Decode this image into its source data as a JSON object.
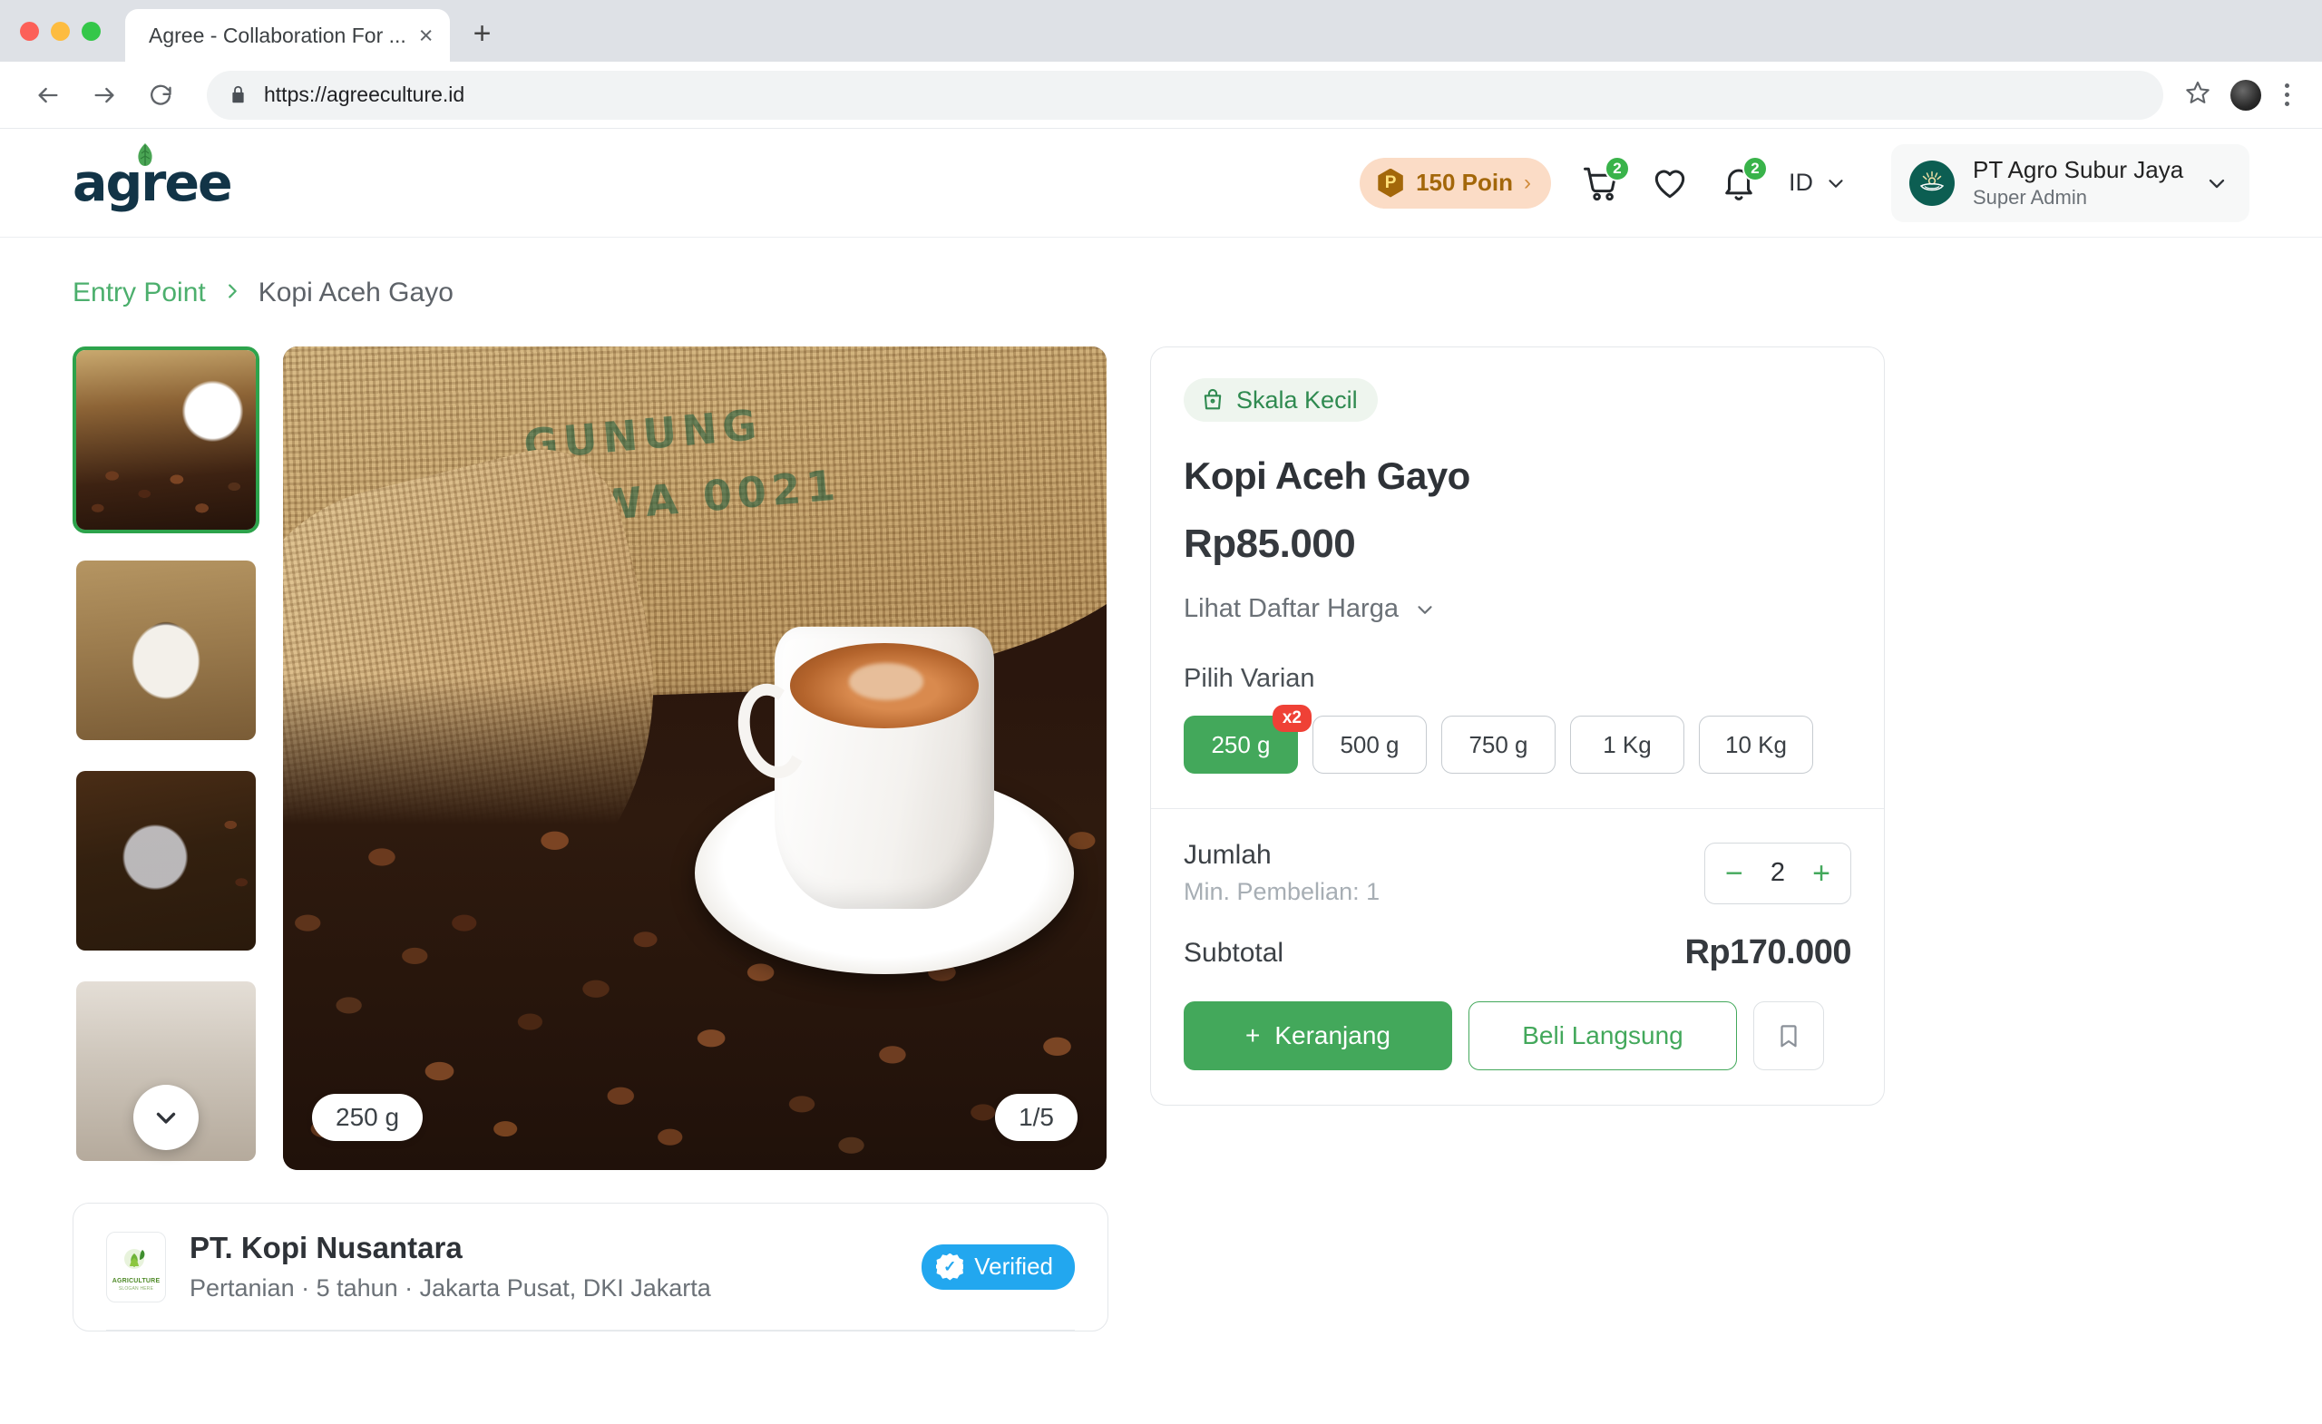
{
  "browser": {
    "tab_title": "Agree - Collaboration For ...",
    "close_label": "×",
    "newtab_label": "+",
    "url": "https://agreeculture.id"
  },
  "header": {
    "logo_text": "agree",
    "points": {
      "label": "150 Poin",
      "icon_letter": "P",
      "chevron": "›"
    },
    "cart": {
      "badge": "2"
    },
    "wishlist": {
      "badge": ""
    },
    "notifications": {
      "badge": "2"
    },
    "language": {
      "label": "ID"
    },
    "profile": {
      "org": "PT Agro Subur Jaya",
      "role": "Super Admin"
    }
  },
  "breadcrumb": {
    "root": "Entry Point",
    "separator": "›",
    "current": "Kopi Aceh Gayo"
  },
  "gallery": {
    "size_pill": "250 g",
    "counter_pill": "1/5",
    "thumbnails": [
      {
        "alt": "coffee beans sack with cup"
      },
      {
        "alt": "cup of black coffee on saucer"
      },
      {
        "alt": "ground coffee with scoop"
      },
      {
        "alt": "coffee pouring"
      }
    ],
    "sack_print": "GUNUNG TAWA\n0021\n100"
  },
  "product": {
    "scale_badge": "Skala Kecil",
    "title": "Kopi Aceh Gayo",
    "price": "Rp85.000",
    "price_list_link": "Lihat Daftar Harga",
    "variant_label": "Pilih Varian",
    "variants": [
      {
        "label": "250 g",
        "selected": true,
        "badge": "x2"
      },
      {
        "label": "500 g",
        "selected": false,
        "badge": ""
      },
      {
        "label": "750 g",
        "selected": false,
        "badge": ""
      },
      {
        "label": "1 Kg",
        "selected": false,
        "badge": ""
      },
      {
        "label": "10 Kg",
        "selected": false,
        "badge": ""
      }
    ],
    "qty_title": "Jumlah",
    "qty_min": "Min. Pembelian: 1",
    "qty_value": "2",
    "qty_minus": "−",
    "qty_plus": "+",
    "subtotal_label": "Subtotal",
    "subtotal_value": "Rp170.000",
    "cart_button": "Keranjang",
    "cart_button_icon": "+",
    "buy_button": "Beli Langsung"
  },
  "seller": {
    "name": "PT. Kopi Nusantara",
    "meta": "Pertanian · 5 tahun · Jakarta Pusat, DKI Jakarta",
    "verified_label": "Verified",
    "logo_caption": "AGRICULTURE",
    "logo_slogan": "SLOGAN HERE"
  },
  "colors": {
    "brand_green": "#43a85b",
    "link_green": "#4caf6d",
    "badge_green": "#39b34a",
    "badge_red": "#ef4136",
    "points_bg": "#fbdcc6",
    "points_fg": "#a3670a",
    "verified_blue": "#22a7ef",
    "logo_navy": "#123447"
  }
}
